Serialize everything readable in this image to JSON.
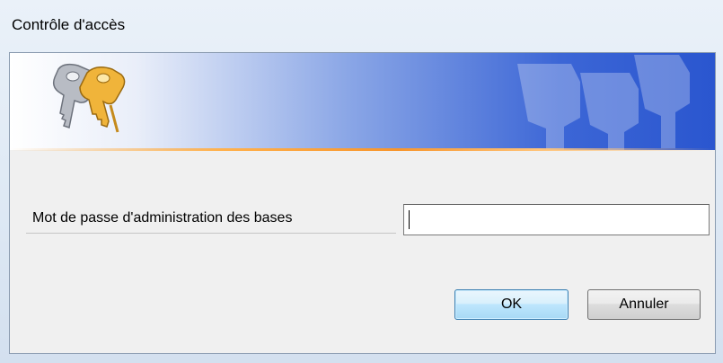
{
  "window": {
    "title": "Contrôle d'accès"
  },
  "banner": {
    "icon": "keys-icon",
    "watermark": "keys-watermark",
    "colors": {
      "start": "#ffffff",
      "end": "#2a56cf",
      "accent_line": "#f7952c"
    }
  },
  "form": {
    "password_label": "Mot de passe d'administration des bases",
    "password_value": "",
    "password_placeholder": ""
  },
  "buttons": {
    "ok_label": "OK",
    "cancel_label": "Annuler"
  }
}
